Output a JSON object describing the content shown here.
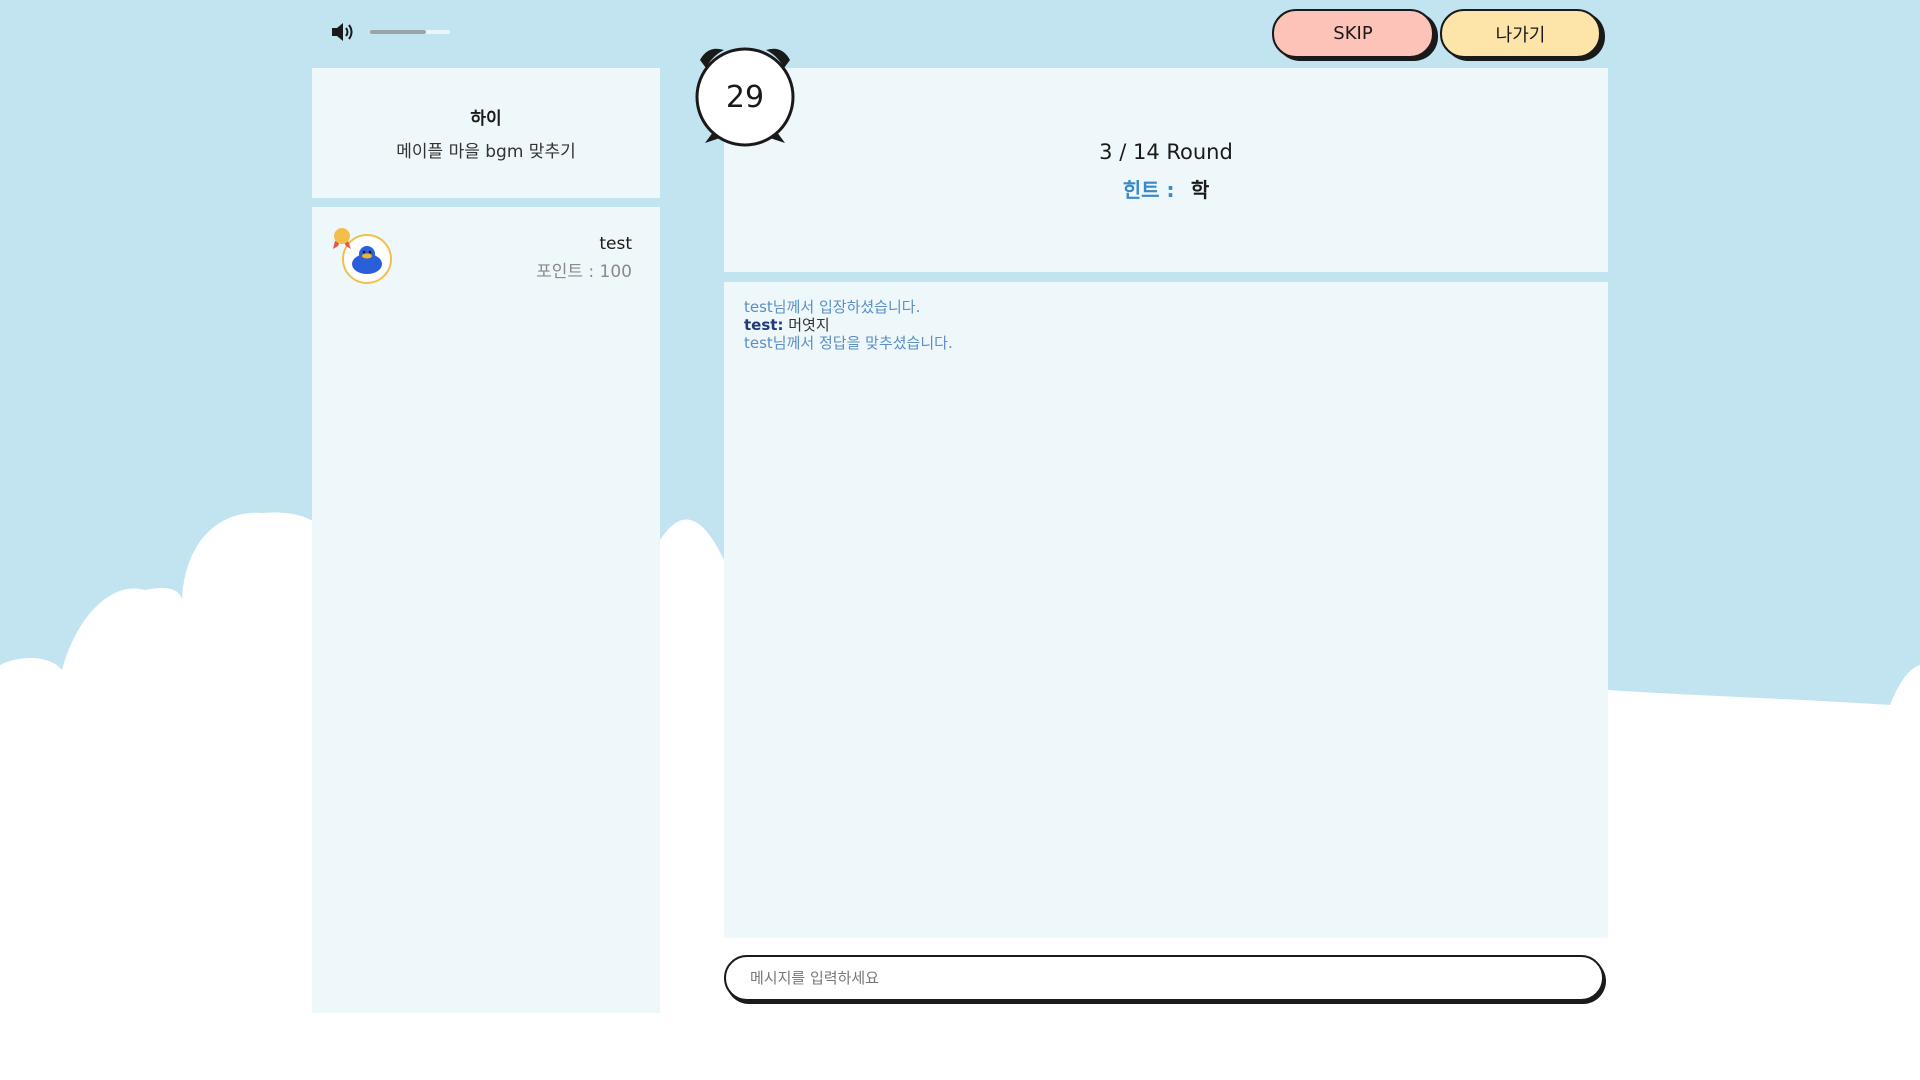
{
  "colors": {
    "sky": "#c2e3f0",
    "panel": "#eef7fa",
    "skip_button": "#fdc3b8",
    "exit_button": "#fde4a8",
    "hint_label": "#3a88c8",
    "system_message": "#5b8fc6"
  },
  "audio": {
    "icon": "speaker-icon",
    "volume_level": 0.7
  },
  "header": {
    "skip_label": "SKIP",
    "exit_label": "나가기"
  },
  "timer": {
    "icon": "alarm-clock-icon",
    "seconds": "29"
  },
  "room": {
    "title": "하이",
    "description": "메이플 마을 bgm 맞추기"
  },
  "players": [
    {
      "name": "test",
      "points_text": "포인트 : 100",
      "rank_icon": "first-place-medal-icon",
      "avatar_icon": "duck-avatar-icon"
    }
  ],
  "round": {
    "text": "3 / 14 Round",
    "hint_label": "힌트 :",
    "hint_value": "학"
  },
  "chat": {
    "messages": [
      {
        "type": "system",
        "text": "test님께서 입장하셨습니다."
      },
      {
        "type": "user",
        "user": "test:",
        "text": "머엿지"
      },
      {
        "type": "system",
        "text": "test님께서 정답을 맞추셨습니다."
      }
    ],
    "input_placeholder": "메시지를 입력하세요",
    "input_value": ""
  }
}
